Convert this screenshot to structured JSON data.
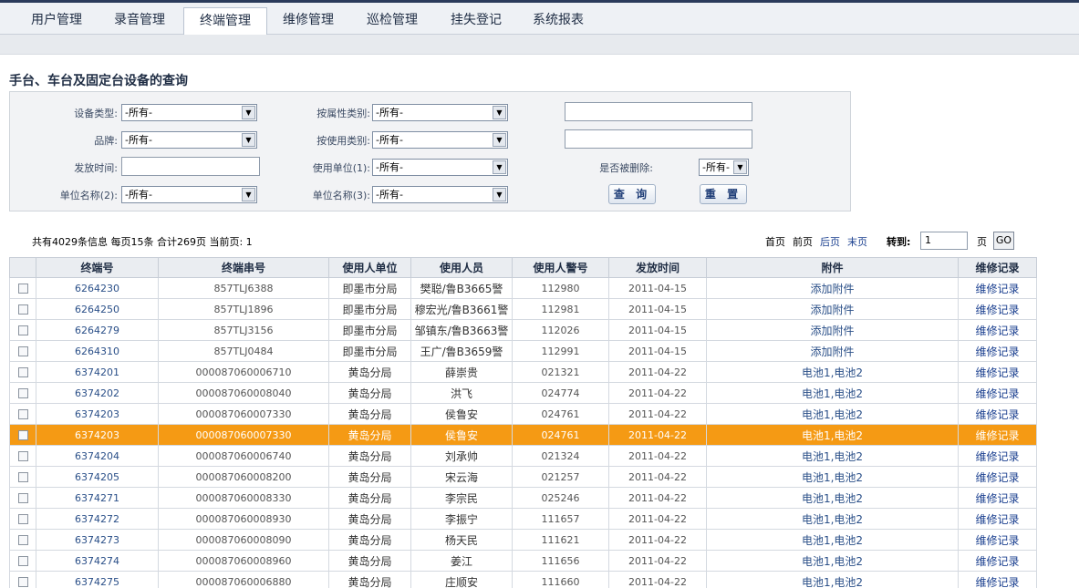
{
  "nav": {
    "tabs": [
      "用户管理",
      "录音管理",
      "终端管理",
      "维修管理",
      "巡检管理",
      "挂失登记",
      "系统报表"
    ],
    "active": "终端管理"
  },
  "page": {
    "title": "手台、车台及固定台设备的查询"
  },
  "query": {
    "device_type": {
      "label": "设备类型:",
      "value": "-所有-"
    },
    "attr_type": {
      "label": "按属性类别:",
      "value": "-所有-"
    },
    "brand": {
      "label": "品牌:",
      "value": "-所有-"
    },
    "use_type": {
      "label": "按使用类别:",
      "value": "-所有-"
    },
    "issue_time": {
      "label": "发放时间:",
      "value": ""
    },
    "unit1": {
      "label": "使用单位(1):",
      "value": "-所有-"
    },
    "deleted": {
      "label": "是否被删除:",
      "value": "-所有-"
    },
    "unit2": {
      "label": "单位名称(2):",
      "value": "-所有-"
    },
    "unit3": {
      "label": "单位名称(3):",
      "value": "-所有-"
    },
    "search_btn": "查 询",
    "reset_btn": "重 置"
  },
  "summary": {
    "text": "共有4029条信息 每页15条 合计269页  当前页: 1"
  },
  "pager": {
    "first": "首页",
    "prev": "前页",
    "next": "后页",
    "last": "末页",
    "goto_label": "转到:",
    "page_value": "1",
    "page_unit": "页",
    "go": "GO"
  },
  "table": {
    "columns": [
      "",
      "终端号",
      "终端串号",
      "使用人单位",
      "使用人员",
      "使用人警号",
      "发放时间",
      "附件",
      "维修记录"
    ],
    "rows": [
      [
        "6264230",
        "857TLJ6388",
        "即墨市分局",
        "樊聪/鲁B3665警",
        "112980",
        "2011-04-15",
        "添加附件",
        "维修记录"
      ],
      [
        "6264250",
        "857TLJ1896",
        "即墨市分局",
        "穆宏光/鲁B3661警",
        "112981",
        "2011-04-15",
        "添加附件",
        "维修记录"
      ],
      [
        "6264279",
        "857TLJ3156",
        "即墨市分局",
        "邹镇东/鲁B3663警",
        "112026",
        "2011-04-15",
        "添加附件",
        "维修记录"
      ],
      [
        "6264310",
        "857TLJ0484",
        "即墨市分局",
        "王广/鲁B3659警",
        "112991",
        "2011-04-15",
        "添加附件",
        "维修记录"
      ],
      [
        "6374201",
        "000087060006710",
        "黄岛分局",
        "薛崇贵",
        "021321",
        "2011-04-22",
        "电池1,电池2",
        "维修记录"
      ],
      [
        "6374202",
        "000087060008040",
        "黄岛分局",
        "洪飞",
        "024774",
        "2011-04-22",
        "电池1,电池2",
        "维修记录"
      ],
      [
        "6374203",
        "000087060007330",
        "黄岛分局",
        "侯鲁安",
        "024761",
        "2011-04-22",
        "电池1,电池2",
        "维修记录"
      ],
      [
        "6374203",
        "000087060007330",
        "黄岛分局",
        "侯鲁安",
        "024761",
        "2011-04-22",
        "电池1,电池2",
        "维修记录"
      ],
      [
        "6374204",
        "000087060006740",
        "黄岛分局",
        "刘承帅",
        "021324",
        "2011-04-22",
        "电池1,电池2",
        "维修记录"
      ],
      [
        "6374205",
        "000087060008200",
        "黄岛分局",
        "宋云海",
        "021257",
        "2011-04-22",
        "电池1,电池2",
        "维修记录"
      ],
      [
        "6374271",
        "000087060008330",
        "黄岛分局",
        "李宗民",
        "025246",
        "2011-04-22",
        "电池1,电池2",
        "维修记录"
      ],
      [
        "6374272",
        "000087060008930",
        "黄岛分局",
        "李振宁",
        "111657",
        "2011-04-22",
        "电池1,电池2",
        "维修记录"
      ],
      [
        "6374273",
        "000087060008090",
        "黄岛分局",
        "杨天民",
        "111621",
        "2011-04-22",
        "电池1,电池2",
        "维修记录"
      ],
      [
        "6374274",
        "000087060008960",
        "黄岛分局",
        "姜江",
        "111656",
        "2011-04-22",
        "电池1,电池2",
        "维修记录"
      ],
      [
        "6374275",
        "000087060006880",
        "黄岛分局",
        "庄顺安",
        "111660",
        "2011-04-22",
        "电池1,电池2",
        "维修记录"
      ]
    ],
    "highlighted_row": 7
  },
  "colors": {
    "highlight": "#f59a14",
    "link": "#1a3f8f",
    "nav_border": "#2a3b5b"
  }
}
